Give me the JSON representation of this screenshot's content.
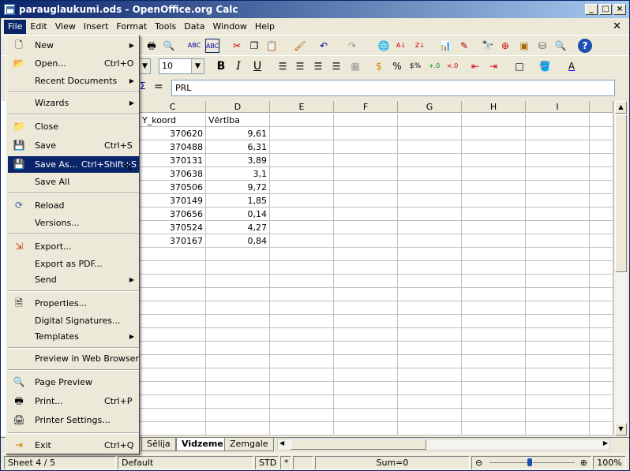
{
  "window": {
    "title": "parauglaukumi.ods - OpenOffice.org Calc"
  },
  "menubar": {
    "items": [
      "File",
      "Edit",
      "View",
      "Insert",
      "Format",
      "Tools",
      "Data",
      "Window",
      "Help"
    ]
  },
  "toolbar": {
    "font_size": "10"
  },
  "formula": {
    "equals": "=",
    "value": "PRL"
  },
  "columns": [
    "C",
    "D",
    "E",
    "F",
    "G",
    "H",
    "I"
  ],
  "table": {
    "header": [
      "Y_koord",
      "Vērtība"
    ],
    "rows": [
      [
        "370620",
        "9,61"
      ],
      [
        "370488",
        "6,31"
      ],
      [
        "370131",
        "3,89"
      ],
      [
        "370638",
        "3,1"
      ],
      [
        "370506",
        "9,72"
      ],
      [
        "370149",
        "1,85"
      ],
      [
        "370656",
        "0,14"
      ],
      [
        "370524",
        "4,27"
      ],
      [
        "370167",
        "0,84"
      ]
    ]
  },
  "sheets": {
    "tabs": [
      "Sēlija",
      "Vidzeme",
      "Zemgale"
    ],
    "active": "Vidzeme"
  },
  "status": {
    "sheet": "Sheet 4 / 5",
    "style": "Default",
    "mode": "STD",
    "modified": "*",
    "sum": "Sum=0",
    "zoom": "100%"
  },
  "file_menu": {
    "items": [
      {
        "label": "New",
        "shortcut": "",
        "submenu": true
      },
      {
        "label": "Open...",
        "shortcut": "Ctrl+O",
        "submenu": false
      },
      {
        "label": "Recent Documents",
        "shortcut": "",
        "submenu": true
      },
      {
        "label": "Wizards",
        "shortcut": "",
        "submenu": true
      },
      {
        "label": "Close",
        "shortcut": "",
        "submenu": false
      },
      {
        "label": "Save",
        "shortcut": "Ctrl+S",
        "submenu": false
      },
      {
        "label": "Save As...",
        "shortcut": "Ctrl+Shift+S",
        "submenu": false
      },
      {
        "label": "Save All",
        "shortcut": "",
        "submenu": false
      },
      {
        "label": "Reload",
        "shortcut": "",
        "submenu": false
      },
      {
        "label": "Versions...",
        "shortcut": "",
        "submenu": false
      },
      {
        "label": "Export...",
        "shortcut": "",
        "submenu": false
      },
      {
        "label": "Export as PDF...",
        "shortcut": "",
        "submenu": false
      },
      {
        "label": "Send",
        "shortcut": "",
        "submenu": true
      },
      {
        "label": "Properties...",
        "shortcut": "",
        "submenu": false
      },
      {
        "label": "Digital Signatures...",
        "shortcut": "",
        "submenu": false
      },
      {
        "label": "Templates",
        "shortcut": "",
        "submenu": true
      },
      {
        "label": "Preview in Web Browser",
        "shortcut": "",
        "submenu": false
      },
      {
        "label": "Page Preview",
        "shortcut": "",
        "submenu": false
      },
      {
        "label": "Print...",
        "shortcut": "Ctrl+P",
        "submenu": false
      },
      {
        "label": "Printer Settings...",
        "shortcut": "",
        "submenu": false
      },
      {
        "label": "Exit",
        "shortcut": "Ctrl+Q",
        "submenu": false
      }
    ]
  }
}
